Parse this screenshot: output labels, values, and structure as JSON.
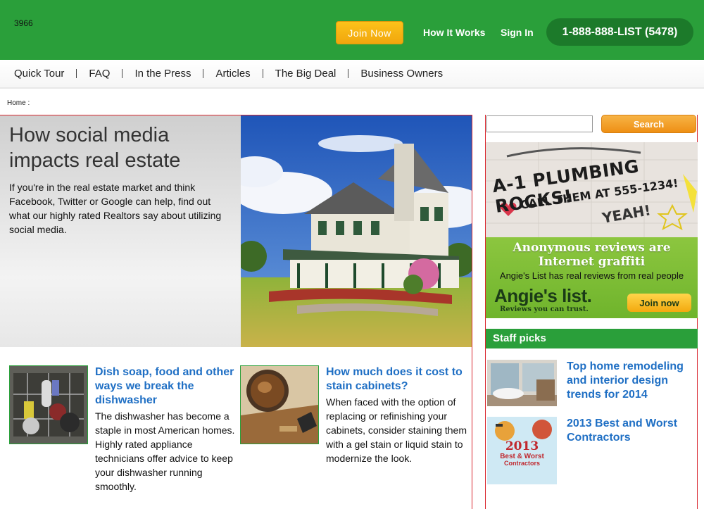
{
  "header": {
    "counter": "3966",
    "join_label": "Join Now",
    "how_it_works": "How It Works",
    "sign_in": "Sign In",
    "phone": "1-888-888-LIST (5478)",
    "brand_color": "#2a9f3a"
  },
  "nav": {
    "items": [
      "Quick Tour",
      "FAQ",
      "In the Press",
      "Articles",
      "The Big Deal",
      "Business Owners"
    ]
  },
  "breadcrumb": "Home :",
  "hero": {
    "title": "How social media impacts real estate",
    "description": "If you're in the real estate market and think Facebook, Twitter or Google can help, find out what our highly rated Realtors say about utilizing social media."
  },
  "articles": [
    {
      "title": "Dish soap, food and other ways we break the dishwasher",
      "body": "The dishwasher has become a staple in most American homes. Highly rated appliance technicians offer advice to keep your dishwasher running smoothly."
    },
    {
      "title": "How much does it cost to stain cabinets?",
      "body": "When faced with the option of replacing or refinishing your cabinets, consider staining them with a gel stain or liquid stain to modernize the look."
    }
  ],
  "sidebar": {
    "search_label": "Search",
    "ad": {
      "graffiti_line1": "A-1 PLUMBING ROCKS!",
      "graffiti_line2": "CALL THEM AT 555-1234!",
      "graffiti_line3": "YEAH!",
      "headline_line1": "Anonymous reviews are",
      "headline_line2": "Internet graffiti",
      "subline": "Angie's List has real reviews from real people",
      "logo": "Angie's list.",
      "tagline": "Reviews you can trust.",
      "join_label": "Join now"
    },
    "staff_picks_title": "Staff picks",
    "picks": [
      {
        "title": "Top home remodeling and interior design trends for 2014"
      },
      {
        "title": "2013 Best and Worst Contractors",
        "badge_year": "2013",
        "badge_line1": "Best & Worst",
        "badge_line2": "Contractors"
      }
    ]
  }
}
